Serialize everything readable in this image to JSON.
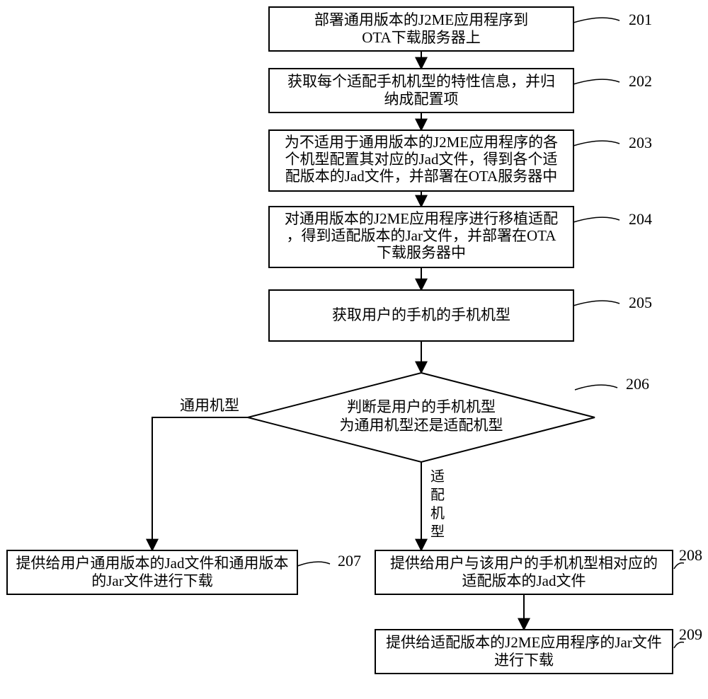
{
  "chart_data": {
    "type": "flowchart",
    "nodes": [
      {
        "id": 201,
        "textLines": [
          "部署通用版本的J2ME应用程序到",
          "OTA下载服务器上"
        ],
        "shape": "rect"
      },
      {
        "id": 202,
        "textLines": [
          "获取每个适配手机机型的特性信息，并归",
          "纳成配置项"
        ],
        "shape": "rect"
      },
      {
        "id": 203,
        "textLines": [
          "为不适用于通用版本的J2ME应用程序的各",
          "个机型配置其对应的Jad文件，得到各个适",
          "配版本的Jad文件，并部署在OTA服务器中"
        ],
        "shape": "rect"
      },
      {
        "id": 204,
        "textLines": [
          "对通用版本的J2ME应用程序进行移植适配",
          "，得到适配版本的Jar文件，并部署在OTA",
          "下载服务器中"
        ],
        "shape": "rect"
      },
      {
        "id": 205,
        "textLines": [
          "获取用户的手机的手机机型"
        ],
        "shape": "rect"
      },
      {
        "id": 206,
        "textLines": [
          "判断是用户的手机机型",
          "为通用机型还是适配机型"
        ],
        "shape": "diamond"
      },
      {
        "id": 207,
        "textLines": [
          "提供给用户通用版本的Jad文件和通用版本",
          "的Jar文件进行下载"
        ],
        "shape": "rect"
      },
      {
        "id": 208,
        "textLines": [
          "提供给用户与该用户的手机机型相对应的",
          "适配版本的Jad文件"
        ],
        "shape": "rect"
      },
      {
        "id": 209,
        "textLines": [
          "提供给适配版本的J2ME应用程序的Jar文件",
          "进行下载"
        ],
        "shape": "rect"
      }
    ],
    "edges": [
      {
        "from": 201,
        "to": 202,
        "label": ""
      },
      {
        "from": 202,
        "to": 203,
        "label": ""
      },
      {
        "from": 203,
        "to": 204,
        "label": ""
      },
      {
        "from": 204,
        "to": 205,
        "label": ""
      },
      {
        "from": 205,
        "to": 206,
        "label": ""
      },
      {
        "from": 206,
        "to": 207,
        "label": "通用机型"
      },
      {
        "from": 206,
        "to": 208,
        "label": "适配机型"
      },
      {
        "from": 208,
        "to": 209,
        "label": ""
      }
    ],
    "edgeLabels": {
      "generic": "通用机型",
      "adaptV": [
        "适",
        "配",
        "机",
        "型"
      ]
    }
  }
}
